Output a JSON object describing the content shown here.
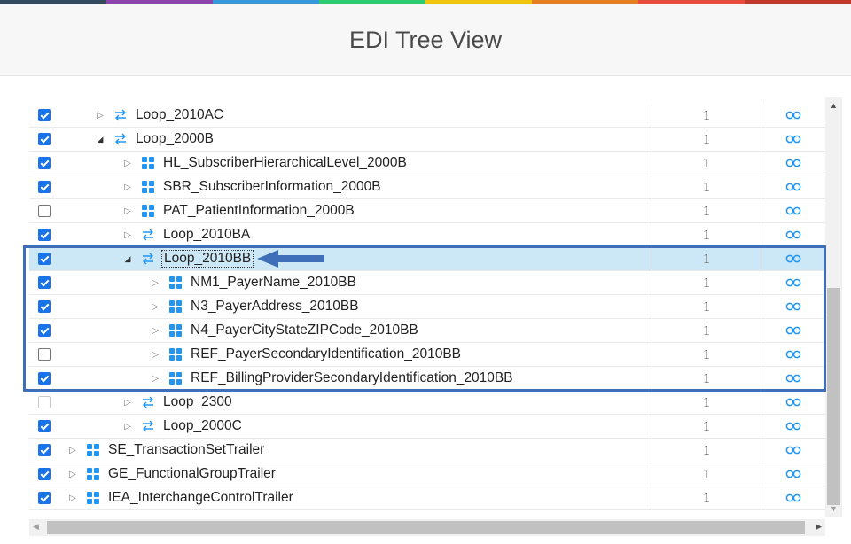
{
  "header": {
    "title": "EDI Tree View"
  },
  "colors": {
    "strip": [
      "#344a5e",
      "#8e44ad",
      "#3498db",
      "#2ecc71",
      "#f1c40f",
      "#e67e22",
      "#e74c3c",
      "#c0392b"
    ],
    "accent": "#1a73e8",
    "selected_row": "#cce8f6",
    "icon_blue": "#2196f3",
    "annotation": "#3f6fb8"
  },
  "rows": [
    {
      "label": "Loop_2010AC",
      "count": "1",
      "checked": true,
      "level": 2,
      "icon": "loop-icon",
      "expanded": false
    },
    {
      "label": "Loop_2000B",
      "count": "1",
      "checked": true,
      "level": 2,
      "icon": "loop-icon",
      "expanded": true
    },
    {
      "label": "HL_SubscriberHierarchicalLevel_2000B",
      "count": "1",
      "checked": true,
      "level": 3,
      "icon": "segment-icon",
      "expanded": false
    },
    {
      "label": "SBR_SubscriberInformation_2000B",
      "count": "1",
      "checked": true,
      "level": 3,
      "icon": "segment-icon",
      "expanded": false
    },
    {
      "label": "PAT_PatientInformation_2000B",
      "count": "1",
      "checked": false,
      "level": 3,
      "icon": "segment-icon",
      "expanded": false
    },
    {
      "label": "Loop_2010BA",
      "count": "1",
      "checked": true,
      "level": 3,
      "icon": "loop-icon",
      "expanded": false
    },
    {
      "label": "Loop_2010BB",
      "count": "1",
      "checked": true,
      "level": 3,
      "icon": "loop-icon",
      "expanded": true,
      "selected": true
    },
    {
      "label": "NM1_PayerName_2010BB",
      "count": "1",
      "checked": true,
      "level": 4,
      "icon": "segment-icon",
      "expanded": false
    },
    {
      "label": "N3_PayerAddress_2010BB",
      "count": "1",
      "checked": true,
      "level": 4,
      "icon": "segment-icon",
      "expanded": false
    },
    {
      "label": "N4_PayerCityStateZIPCode_2010BB",
      "count": "1",
      "checked": true,
      "level": 4,
      "icon": "segment-icon",
      "expanded": false
    },
    {
      "label": "REF_PayerSecondaryIdentification_2010BB",
      "count": "1",
      "checked": false,
      "level": 4,
      "icon": "segment-icon",
      "expanded": false
    },
    {
      "label": "REF_BillingProviderSecondaryIdentification_2010BB",
      "count": "1",
      "checked": true,
      "level": 4,
      "icon": "segment-icon",
      "expanded": false
    },
    {
      "label": "Loop_2300",
      "count": "1",
      "checked": false,
      "disabled": true,
      "level": 3,
      "icon": "loop-icon",
      "expanded": false
    },
    {
      "label": "Loop_2000C",
      "count": "1",
      "checked": true,
      "level": 3,
      "icon": "loop-icon",
      "expanded": false
    },
    {
      "label": "SE_TransactionSetTrailer",
      "count": "1",
      "checked": true,
      "level": 1,
      "icon": "segment-icon",
      "expanded": false
    },
    {
      "label": "GE_FunctionalGroupTrailer",
      "count": "1",
      "checked": true,
      "level": 1,
      "icon": "segment-icon",
      "expanded": false
    },
    {
      "label": "IEA_InterchangeControlTrailer",
      "count": "1",
      "checked": true,
      "level": 1,
      "icon": "segment-icon",
      "expanded": false
    }
  ]
}
